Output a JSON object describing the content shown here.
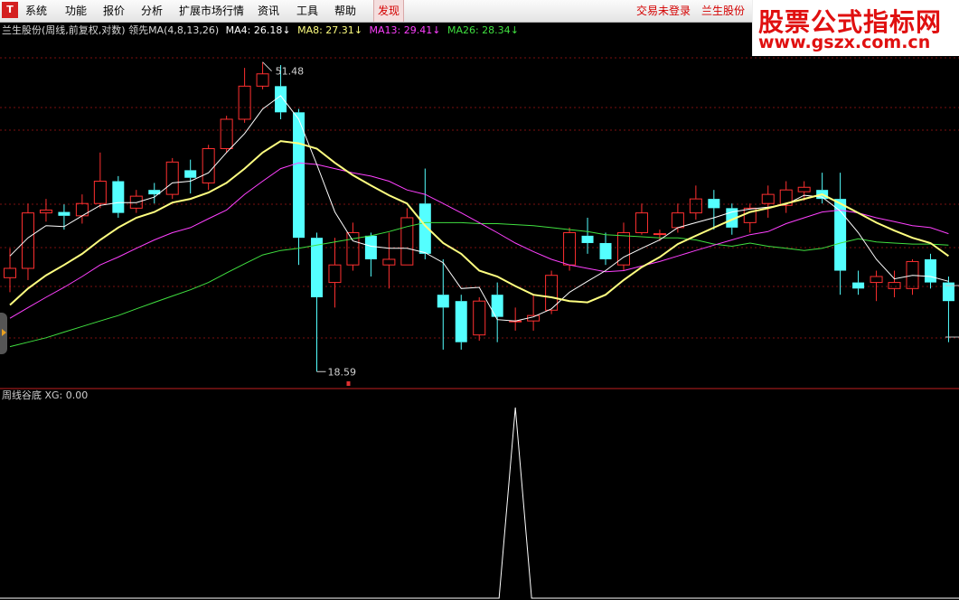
{
  "menu": {
    "items": [
      {
        "id": "system",
        "label": "系统"
      },
      {
        "id": "function",
        "label": "功能"
      },
      {
        "id": "report",
        "label": "报价"
      },
      {
        "id": "analysis",
        "label": "分析"
      },
      {
        "id": "market",
        "label": "扩展市场行情"
      },
      {
        "id": "news",
        "label": "资讯"
      },
      {
        "id": "tools",
        "label": "工具"
      },
      {
        "id": "help",
        "label": "帮助"
      },
      {
        "id": "discover",
        "label": "发现"
      }
    ],
    "trade_status": "交易未登录",
    "stock_name_link": "兰生股份"
  },
  "watermark": {
    "line1": "股票公式指标网",
    "line2": "www.gszx.com.cn"
  },
  "indicator_header": {
    "title": "兰生股份(周线,前复权,对数) 领先MA(4,8,13,26)",
    "ma4": "MA4: 26.18",
    "ma8": "MA8: 27.31",
    "ma13": "MA13: 29.41",
    "ma26": "MA26: 28.34",
    "arrow": "↓"
  },
  "sub_header": "周线谷底  XG: 0.00",
  "price_labels": {
    "high": "51.48",
    "low": "18.59"
  },
  "colors": {
    "up": "#ff3030",
    "down": "#54ffff",
    "ma4": "#ffffff",
    "ma8": "#ffff80",
    "ma13": "#ff40ff",
    "ma26": "#40e040",
    "grid": "#7a1010",
    "divider": "#c02020",
    "bg": "#000000"
  },
  "chart_data": {
    "type": "candlestick",
    "scale": "log",
    "ylim": [
      18.0,
      56.0
    ],
    "candles": [
      [
        25.4,
        28.0,
        24.2,
        26.2
      ],
      [
        26.2,
        32.5,
        25.2,
        31.5
      ],
      [
        31.5,
        33.0,
        30.6,
        31.8
      ],
      [
        31.6,
        32.4,
        29.8,
        31.2
      ],
      [
        31.2,
        33.5,
        30.4,
        32.5
      ],
      [
        32.5,
        38.5,
        32.0,
        35.0
      ],
      [
        35.0,
        35.6,
        31.0,
        31.5
      ],
      [
        32.0,
        34.0,
        31.5,
        33.3
      ],
      [
        34.0,
        34.8,
        32.5,
        33.5
      ],
      [
        33.5,
        37.8,
        33.0,
        37.3
      ],
      [
        36.3,
        37.6,
        33.6,
        35.4
      ],
      [
        34.8,
        39.5,
        34.0,
        39.0
      ],
      [
        39.0,
        43.5,
        38.5,
        43.0
      ],
      [
        43.0,
        51.0,
        42.5,
        48.0
      ],
      [
        48.0,
        52.0,
        47.5,
        50.0
      ],
      [
        48.0,
        51.48,
        43.0,
        44.0
      ],
      [
        44.0,
        44.5,
        26.5,
        29.0
      ],
      [
        29.0,
        29.5,
        18.59,
        23.8
      ],
      [
        25.0,
        29.0,
        23.0,
        26.5
      ],
      [
        26.5,
        30.5,
        26.0,
        29.5
      ],
      [
        29.2,
        29.5,
        25.5,
        27.0
      ],
      [
        26.5,
        29.5,
        24.5,
        27.0
      ],
      [
        26.5,
        32.0,
        26.5,
        31.0
      ],
      [
        32.5,
        36.5,
        27.0,
        27.5
      ],
      [
        24.0,
        27.0,
        20.0,
        23.0
      ],
      [
        23.5,
        24.0,
        20.0,
        20.5
      ],
      [
        21.0,
        23.8,
        20.6,
        23.5
      ],
      [
        24.0,
        25.0,
        20.5,
        22.3
      ],
      [
        22.0,
        23.0,
        21.3,
        22.0
      ],
      [
        22.0,
        24.0,
        21.3,
        22.4
      ],
      [
        22.8,
        26.0,
        22.5,
        25.6
      ],
      [
        26.5,
        30.0,
        26.0,
        29.5
      ],
      [
        29.2,
        31.0,
        27.5,
        28.5
      ],
      [
        28.5,
        29.5,
        26.5,
        27.0
      ],
      [
        26.5,
        30.5,
        26.0,
        29.5
      ],
      [
        29.5,
        32.5,
        29.3,
        31.5
      ],
      [
        29.4,
        29.8,
        28.7,
        29.4
      ],
      [
        30.0,
        32.5,
        29.5,
        31.5
      ],
      [
        31.5,
        34.5,
        30.8,
        33.0
      ],
      [
        33.0,
        34.0,
        29.8,
        32.0
      ],
      [
        32.0,
        32.5,
        29.3,
        30.0
      ],
      [
        30.5,
        32.5,
        29.5,
        32.0
      ],
      [
        32.5,
        34.5,
        31.0,
        33.5
      ],
      [
        32.3,
        35.0,
        31.5,
        34.0
      ],
      [
        33.8,
        35.0,
        32.8,
        34.3
      ],
      [
        34.0,
        36.0,
        32.5,
        33.0
      ],
      [
        33.0,
        36.0,
        24.0,
        26.0
      ],
      [
        25.0,
        26.0,
        24.0,
        24.5
      ],
      [
        25.0,
        26.0,
        23.5,
        25.5
      ],
      [
        24.5,
        26.0,
        23.8,
        25.0
      ],
      [
        24.5,
        27.0,
        24.0,
        26.8
      ],
      [
        27.0,
        27.5,
        24.5,
        25.0
      ],
      [
        25.0,
        25.5,
        20.5,
        23.5
      ]
    ],
    "ma4": [
      27.3,
      29.0,
      30.2,
      30.1,
      31.2,
      32.3,
      32.6,
      32.6,
      33.2,
      34.8,
      35.0,
      36.0,
      38.5,
      41.0,
      44.5,
      46.5,
      43.0,
      37.0,
      31.6,
      28.7,
      28.2,
      28.0,
      28.0,
      27.6,
      26.7,
      24.5,
      24.6,
      22.1,
      22.0,
      22.3,
      22.9,
      24.2,
      25.1,
      26.0,
      27.2,
      28.0,
      28.8,
      30.0,
      30.5,
      31.0,
      31.6,
      31.9,
      32.1,
      32.4,
      33.4,
      33.2,
      31.7,
      29.5,
      27.0,
      25.3,
      25.6,
      25.5,
      25.1
    ],
    "ma8": [
      23.2,
      24.5,
      25.6,
      26.5,
      27.5,
      28.8,
      30.0,
      31.0,
      31.6,
      32.6,
      33.0,
      33.7,
      34.8,
      36.5,
      38.5,
      40.0,
      39.7,
      39.0,
      37.2,
      35.7,
      34.5,
      33.4,
      32.5,
      30.2,
      28.5,
      27.5,
      26.0,
      25.5,
      24.7,
      24.0,
      23.8,
      23.5,
      23.4,
      24.0,
      25.2,
      26.3,
      27.2,
      28.4,
      29.2,
      30.0,
      30.8,
      31.6,
      32.0,
      32.5,
      33.0,
      33.5,
      32.5,
      31.5,
      30.5,
      29.7,
      29.0,
      28.5,
      27.3
    ],
    "ma13": [
      22.2,
      23.0,
      23.8,
      24.6,
      25.5,
      26.5,
      27.2,
      28.0,
      28.8,
      29.5,
      30.0,
      30.9,
      31.8,
      33.5,
      35.0,
      36.5,
      37.2,
      37.0,
      36.5,
      36.0,
      35.6,
      35.0,
      34.0,
      33.5,
      32.5,
      31.5,
      30.5,
      29.5,
      28.5,
      27.7,
      27.0,
      26.5,
      26.2,
      25.9,
      26.0,
      26.4,
      26.8,
      27.3,
      27.8,
      28.3,
      28.8,
      29.3,
      29.6,
      30.4,
      31.0,
      31.6,
      31.8,
      31.5,
      31.0,
      30.6,
      30.2,
      30.0,
      29.4
    ],
    "ma26": [
      20.2,
      20.5,
      20.8,
      21.2,
      21.6,
      22.0,
      22.4,
      22.9,
      23.4,
      23.9,
      24.4,
      25.0,
      25.8,
      26.6,
      27.4,
      27.8,
      28.0,
      28.3,
      28.6,
      28.9,
      29.2,
      29.6,
      30.1,
      30.5,
      30.5,
      30.5,
      30.4,
      30.4,
      30.3,
      30.2,
      30.0,
      29.8,
      29.6,
      29.3,
      29.2,
      29.1,
      29.0,
      29.0,
      28.8,
      28.4,
      28.2,
      28.5,
      28.2,
      28.0,
      27.8,
      28.0,
      28.5,
      28.9,
      28.6,
      28.5,
      28.4,
      28.4,
      28.3
    ],
    "xg_peak_index": 28
  }
}
